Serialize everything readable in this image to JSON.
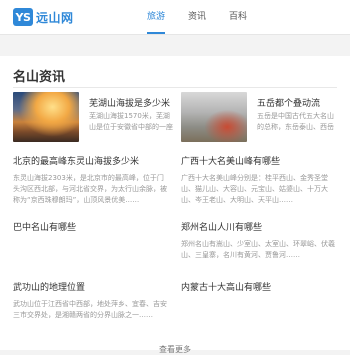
{
  "logo": {
    "badge": "YS",
    "text": "远山网"
  },
  "nav": {
    "items": [
      "旅游",
      "资讯",
      "百科"
    ],
    "active_index": 0
  },
  "section": {
    "title": "名山资讯"
  },
  "featured": [
    {
      "title": "芜湖山海拔是多少米",
      "desc": "芜湖山海拔1570米，芜湖山是位于安徽省中部的一座名山……"
    },
    {
      "title": "五岳都个叠动流",
      "desc": "五岳是中国古代五大名山的总称，东岳泰山、西岳华山……"
    }
  ],
  "list": [
    {
      "title": "北京的最高峰东灵山海拔多少米",
      "desc": "东灵山海拔2303米，是北京市的最高峰，位于门头沟区西北部，与河北省交界，为太行山余脉，被称为“京西珠穆朗玛”，山顶风景优美……"
    },
    {
      "title": "广西十大名美山峰有哪些",
      "desc": "广西十大名美山峰分别是：桂平西山、金秀圣堂山、猫儿山、大容山、元宝山、姑婆山、十万大山、岑王老山、大明山、天平山……"
    },
    {
      "title": "巴中名山有哪些",
      "desc": ""
    },
    {
      "title": "郑州名山人川有哪些",
      "desc": "郑州名山有嵩山、少室山、太室山、环翠峪、伏羲山、三皇寨，名川有黄河、贾鲁河……"
    },
    {
      "title": "武功山的地理位置",
      "desc": "武功山位于江西省中西部，地处萍乡、宜春、吉安三市交界处，是湘赣两省的分界山脉之一……"
    },
    {
      "title": "内蒙古十大高山有哪些",
      "desc": ""
    }
  ],
  "footer": {
    "more": "查看更多"
  }
}
